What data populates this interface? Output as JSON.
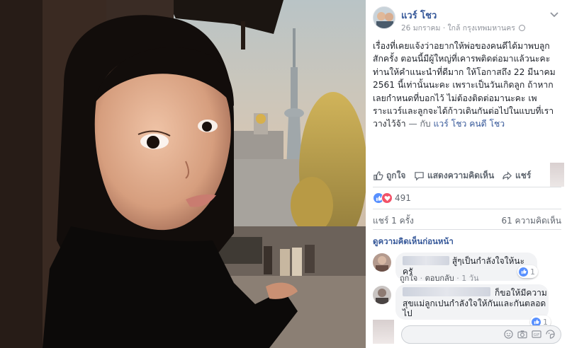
{
  "post": {
    "author": "แวร์ โชว",
    "date": "26 มกราคม",
    "location": "ใกล้ กรุงเทพมหานคร",
    "text_lines": [
      "เรื่องที่เคยแจ้งว่าอยากให้พ่อของคนดีได้มาพบลูก",
      "สักครั้ง ตอนนี้มีผู้ใหญ่ที่เคารพติดต่อมาแล้วนะคะ",
      "ท่านให้คำแนะนำที่ดีมาก ให้โอกาสถึง 22 มีนาคม",
      "2561 นี้เท่านั้นนะคะ เพราะเป็นวันเกิดลูก ถ้าหาก",
      "เลยกำหนดที่บอกไว้ ไม่ต้องติดต่อมานะคะ เพ",
      "ราะแวร์และลูกจะได้ก้าวเดินกันต่อไปในแบบที่เรา"
    ],
    "last_line": "วางไว้จ้า",
    "tag_prefix": "— กับ",
    "tagged": "แวร์ โชว คนดี โชว"
  },
  "actions": {
    "like": "ถูกใจ",
    "comment": "แสดงความคิดเห็น",
    "share": "แชร์"
  },
  "stats": {
    "reactions": "491",
    "shares": "แชร์ 1 ครั้ง",
    "comments": "61 ความคิดเห็น",
    "previous": "ดูความคิดเห็นก่อนหน้า"
  },
  "comments": [
    {
      "text": "สู้ๆเป็นกำลังใจให้นะครั",
      "like": "ถูกใจ",
      "reply": "ตอบกลับ",
      "time": "1 วัน",
      "likes": "1"
    },
    {
      "text_lines": [
        "ก็ขอให้มีความ",
        "สุขแม่ลูกเปนกำลังใจให้กันและกันตลอด",
        "ไป"
      ],
      "likes": "1"
    }
  ],
  "colors": {
    "link": "#365899",
    "muted": "#90949c",
    "like_blue": "#5890ff",
    "love_red": "#f25268"
  }
}
